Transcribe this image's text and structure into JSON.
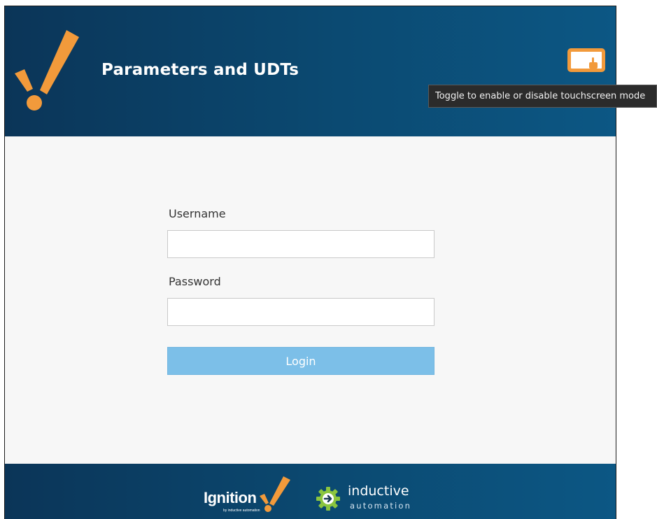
{
  "header": {
    "title": "Parameters and UDTs",
    "logo_icon": "ignition-exclamation-logo",
    "touch_toggle_icon": "touchscreen-toggle-icon"
  },
  "login": {
    "username_label": "Username",
    "username_value": "",
    "password_label": "Password",
    "password_value": "",
    "login_button": "Login"
  },
  "footer": {
    "ignition_wordmark": "Ignition",
    "ignition_subtext": "by inductive automation",
    "ia_word_top": "inductive",
    "ia_word_bottom": "automation"
  },
  "tooltip": {
    "text": "Toggle to enable or disable touchscreen mode"
  },
  "colors": {
    "header_gradient_start": "#0b3558",
    "header_gradient_end": "#0c5784",
    "accent_orange": "#f29a3b",
    "login_button_bg": "#7cbfe8",
    "page_bg": "#f7f7f7",
    "gear_green": "#8bc53f"
  }
}
